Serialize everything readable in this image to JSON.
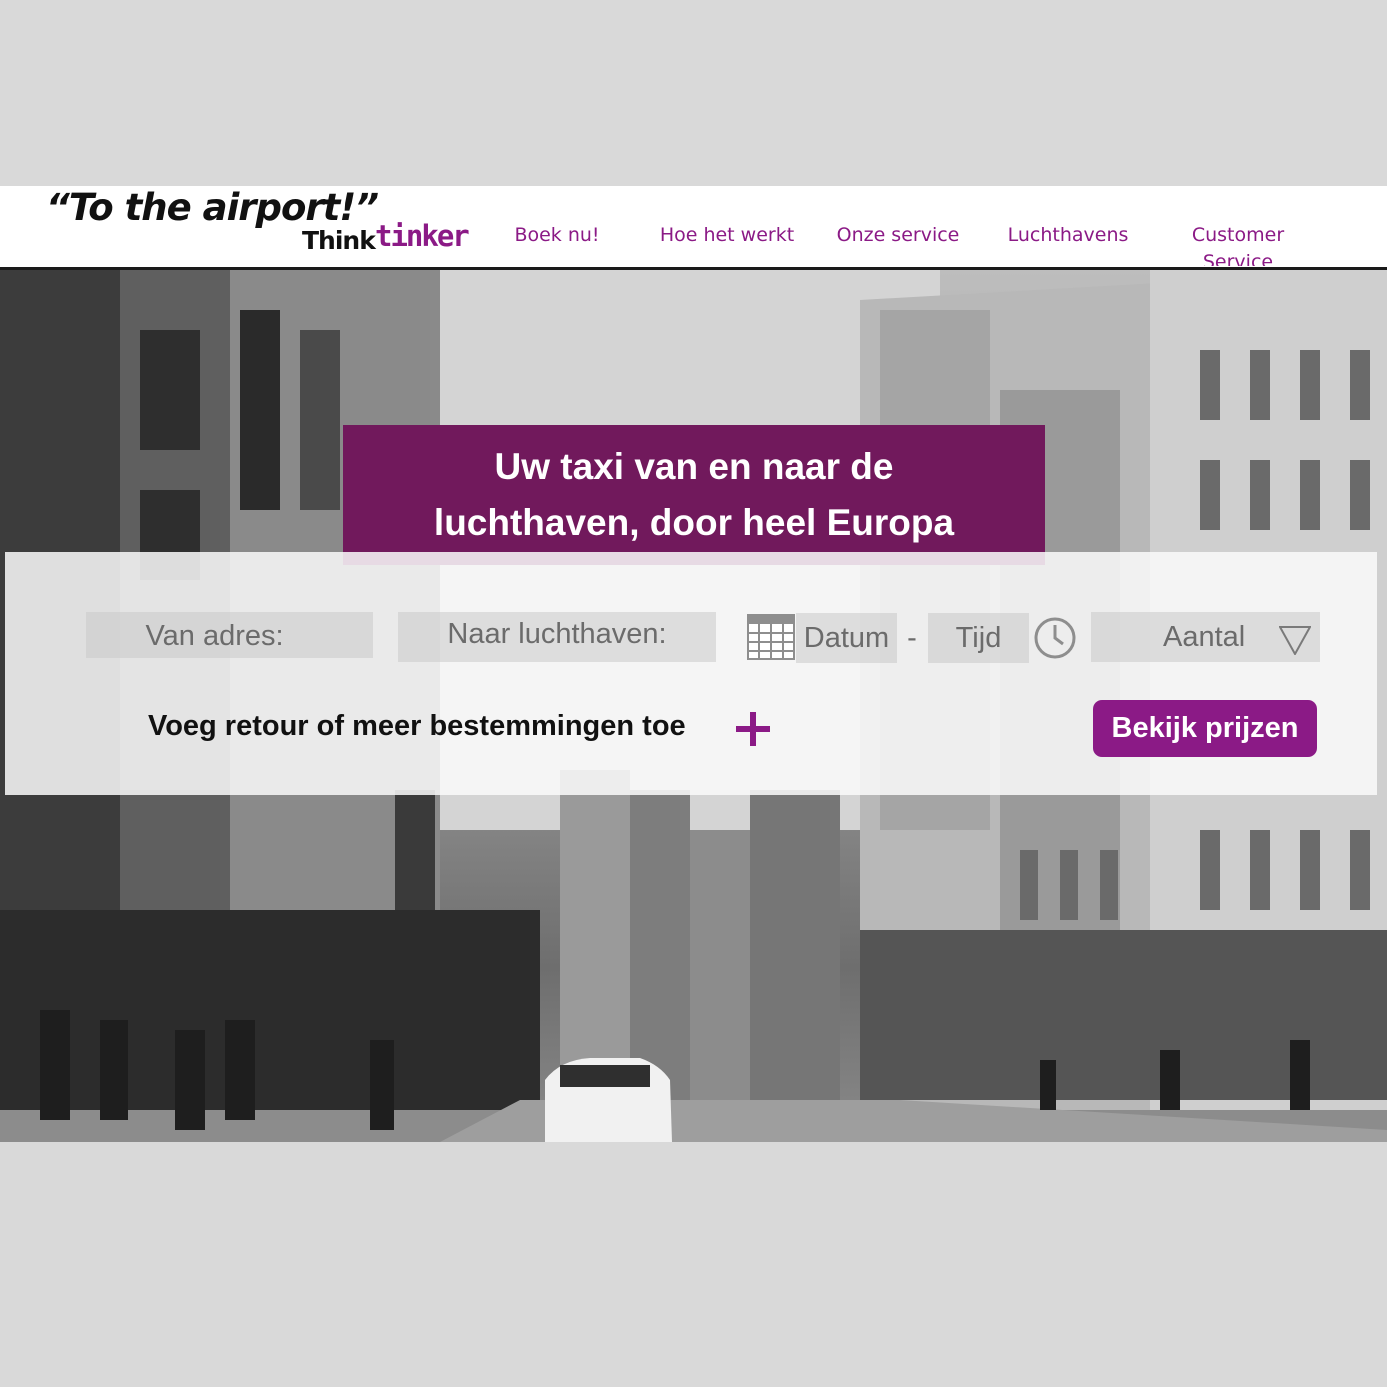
{
  "logo": {
    "slogan": "“To the airport!”",
    "brand_think": "Think",
    "brand_tinker": "tinker"
  },
  "nav": [
    {
      "label": "Boek nu!"
    },
    {
      "label": "Hoe het werkt"
    },
    {
      "label": "Onze service"
    },
    {
      "label": "Luchthavens"
    },
    {
      "label": "Customer Service"
    }
  ],
  "hero": {
    "headline_line1": "Uw taxi van en naar de",
    "headline_line2": "luchthaven, door heel Europa"
  },
  "booking": {
    "from_placeholder": "Van adres:",
    "to_placeholder": "Naar luchthaven:",
    "date_placeholder": "Datum",
    "separator": "-",
    "time_placeholder": "Tijd",
    "count_placeholder": "Aantal",
    "add_more_label": "Voeg retour of meer bestemmingen toe",
    "submit_label": "Bekijk prijzen"
  },
  "colors": {
    "brand": "#8b1a86",
    "headline_bg": "#71195c"
  }
}
